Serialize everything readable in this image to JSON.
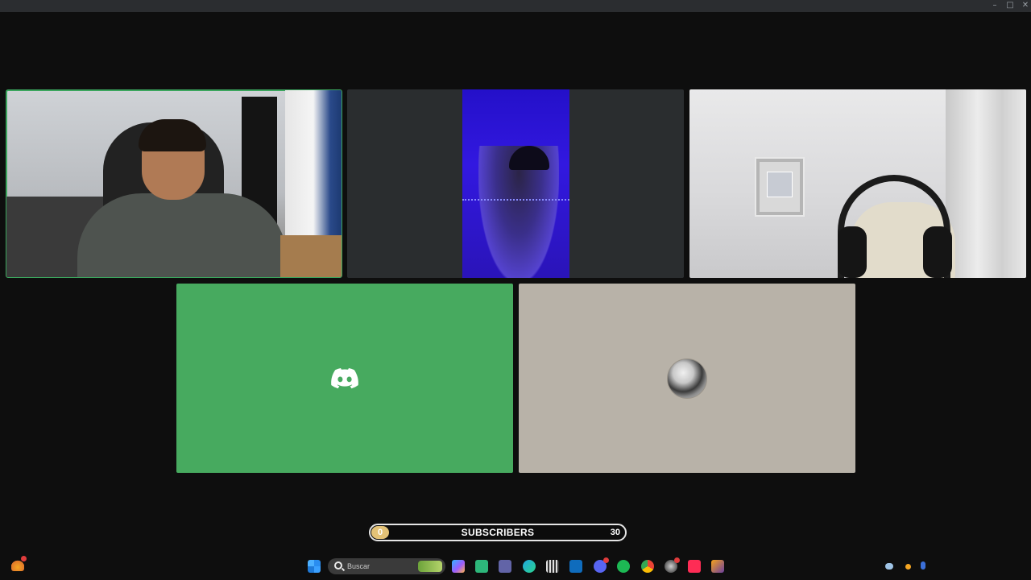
{
  "window": {
    "minimize_glyph": "–",
    "maximize_glyph": "□",
    "close_glyph": "✕"
  },
  "tiles": [
    {
      "id": "participant-1",
      "speaking": true
    },
    {
      "id": "participant-2",
      "speaking": false
    },
    {
      "id": "participant-3",
      "speaking": false
    },
    {
      "id": "participant-4",
      "placeholder": "discord-logo-icon",
      "bg": "#47aa5f"
    },
    {
      "id": "participant-5",
      "placeholder": "avatar",
      "bg": "#b8b2a8"
    }
  ],
  "subscribers": {
    "left_count": "0",
    "label": "SUBSCRIBERS",
    "right_count": "30",
    "accent": "#e3c277"
  },
  "taskbar": {
    "search_placeholder": "Buscar",
    "icons": [
      "start-icon",
      "copilot-icon",
      "app-icon",
      "teams-icon",
      "edge-icon",
      "app-icon",
      "outlook-icon",
      "discord-icon",
      "spotify-icon",
      "chrome-icon",
      "app-icon",
      "tiktok-icon",
      "app-icon"
    ]
  }
}
